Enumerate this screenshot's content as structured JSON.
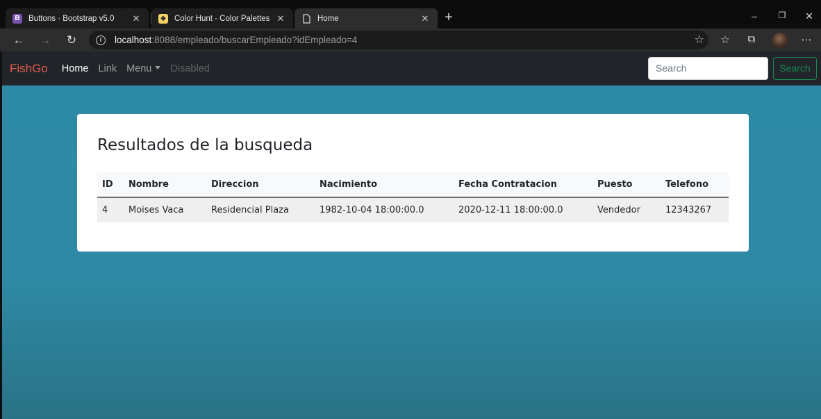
{
  "browser": {
    "tabs": [
      {
        "title": "Buttons · Bootstrap v5.0",
        "icon": "bootstrap-icon"
      },
      {
        "title": "Color Hunt - Color Palettes for D",
        "icon": "colorhunt-icon"
      },
      {
        "title": "Home",
        "icon": "page-icon"
      }
    ],
    "url_host": "localhost",
    "url_rest": ":8088/empleado/buscarEmpleado?idEmpleado=4"
  },
  "navbar": {
    "brand": "FishGo",
    "links": [
      "Home",
      "Link",
      "Menu",
      "Disabled"
    ],
    "search_placeholder": "Search",
    "search_button": "Search"
  },
  "results": {
    "title": "Resultados de la busqueda",
    "columns": [
      "ID",
      "Nombre",
      "Direccion",
      "Nacimiento",
      "Fecha Contratacion",
      "Puesto",
      "Telefono"
    ],
    "rows": [
      [
        "4",
        "Moises Vaca",
        "Residencial Plaza",
        "1982-10-04 18:00:00.0",
        "2020-12-11 18:00:00.0",
        "Vendedor",
        "12343267"
      ]
    ]
  },
  "colors": {
    "brand": "#e65b4e",
    "page_background": "#2d8aa5",
    "search_button": "#198754"
  }
}
